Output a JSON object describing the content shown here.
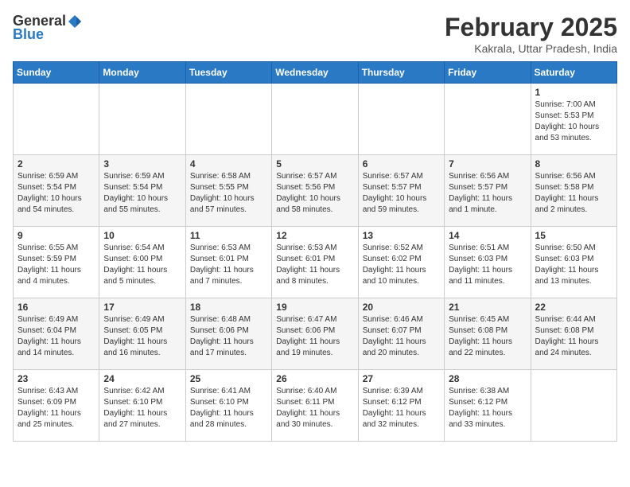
{
  "header": {
    "logo_general": "General",
    "logo_blue": "Blue",
    "title": "February 2025",
    "subtitle": "Kakrala, Uttar Pradesh, India"
  },
  "weekdays": [
    "Sunday",
    "Monday",
    "Tuesday",
    "Wednesday",
    "Thursday",
    "Friday",
    "Saturday"
  ],
  "weeks": [
    [
      {
        "day": null
      },
      {
        "day": null
      },
      {
        "day": null
      },
      {
        "day": null
      },
      {
        "day": null
      },
      {
        "day": null
      },
      {
        "day": 1,
        "sunrise": "7:00 AM",
        "sunset": "5:53 PM",
        "daylight": "Daylight: 10 hours and 53 minutes."
      }
    ],
    [
      {
        "day": 2,
        "sunrise": "6:59 AM",
        "sunset": "5:54 PM",
        "daylight": "Daylight: 10 hours and 54 minutes."
      },
      {
        "day": 3,
        "sunrise": "6:59 AM",
        "sunset": "5:54 PM",
        "daylight": "Daylight: 10 hours and 55 minutes."
      },
      {
        "day": 4,
        "sunrise": "6:58 AM",
        "sunset": "5:55 PM",
        "daylight": "Daylight: 10 hours and 57 minutes."
      },
      {
        "day": 5,
        "sunrise": "6:57 AM",
        "sunset": "5:56 PM",
        "daylight": "Daylight: 10 hours and 58 minutes."
      },
      {
        "day": 6,
        "sunrise": "6:57 AM",
        "sunset": "5:57 PM",
        "daylight": "Daylight: 10 hours and 59 minutes."
      },
      {
        "day": 7,
        "sunrise": "6:56 AM",
        "sunset": "5:57 PM",
        "daylight": "Daylight: 11 hours and 1 minute."
      },
      {
        "day": 8,
        "sunrise": "6:56 AM",
        "sunset": "5:58 PM",
        "daylight": "Daylight: 11 hours and 2 minutes."
      }
    ],
    [
      {
        "day": 9,
        "sunrise": "6:55 AM",
        "sunset": "5:59 PM",
        "daylight": "Daylight: 11 hours and 4 minutes."
      },
      {
        "day": 10,
        "sunrise": "6:54 AM",
        "sunset": "6:00 PM",
        "daylight": "Daylight: 11 hours and 5 minutes."
      },
      {
        "day": 11,
        "sunrise": "6:53 AM",
        "sunset": "6:01 PM",
        "daylight": "Daylight: 11 hours and 7 minutes."
      },
      {
        "day": 12,
        "sunrise": "6:53 AM",
        "sunset": "6:01 PM",
        "daylight": "Daylight: 11 hours and 8 minutes."
      },
      {
        "day": 13,
        "sunrise": "6:52 AM",
        "sunset": "6:02 PM",
        "daylight": "Daylight: 11 hours and 10 minutes."
      },
      {
        "day": 14,
        "sunrise": "6:51 AM",
        "sunset": "6:03 PM",
        "daylight": "Daylight: 11 hours and 11 minutes."
      },
      {
        "day": 15,
        "sunrise": "6:50 AM",
        "sunset": "6:03 PM",
        "daylight": "Daylight: 11 hours and 13 minutes."
      }
    ],
    [
      {
        "day": 16,
        "sunrise": "6:49 AM",
        "sunset": "6:04 PM",
        "daylight": "Daylight: 11 hours and 14 minutes."
      },
      {
        "day": 17,
        "sunrise": "6:49 AM",
        "sunset": "6:05 PM",
        "daylight": "Daylight: 11 hours and 16 minutes."
      },
      {
        "day": 18,
        "sunrise": "6:48 AM",
        "sunset": "6:06 PM",
        "daylight": "Daylight: 11 hours and 17 minutes."
      },
      {
        "day": 19,
        "sunrise": "6:47 AM",
        "sunset": "6:06 PM",
        "daylight": "Daylight: 11 hours and 19 minutes."
      },
      {
        "day": 20,
        "sunrise": "6:46 AM",
        "sunset": "6:07 PM",
        "daylight": "Daylight: 11 hours and 20 minutes."
      },
      {
        "day": 21,
        "sunrise": "6:45 AM",
        "sunset": "6:08 PM",
        "daylight": "Daylight: 11 hours and 22 minutes."
      },
      {
        "day": 22,
        "sunrise": "6:44 AM",
        "sunset": "6:08 PM",
        "daylight": "Daylight: 11 hours and 24 minutes."
      }
    ],
    [
      {
        "day": 23,
        "sunrise": "6:43 AM",
        "sunset": "6:09 PM",
        "daylight": "Daylight: 11 hours and 25 minutes."
      },
      {
        "day": 24,
        "sunrise": "6:42 AM",
        "sunset": "6:10 PM",
        "daylight": "Daylight: 11 hours and 27 minutes."
      },
      {
        "day": 25,
        "sunrise": "6:41 AM",
        "sunset": "6:10 PM",
        "daylight": "Daylight: 11 hours and 28 minutes."
      },
      {
        "day": 26,
        "sunrise": "6:40 AM",
        "sunset": "6:11 PM",
        "daylight": "Daylight: 11 hours and 30 minutes."
      },
      {
        "day": 27,
        "sunrise": "6:39 AM",
        "sunset": "6:12 PM",
        "daylight": "Daylight: 11 hours and 32 minutes."
      },
      {
        "day": 28,
        "sunrise": "6:38 AM",
        "sunset": "6:12 PM",
        "daylight": "Daylight: 11 hours and 33 minutes."
      },
      {
        "day": null
      }
    ]
  ]
}
